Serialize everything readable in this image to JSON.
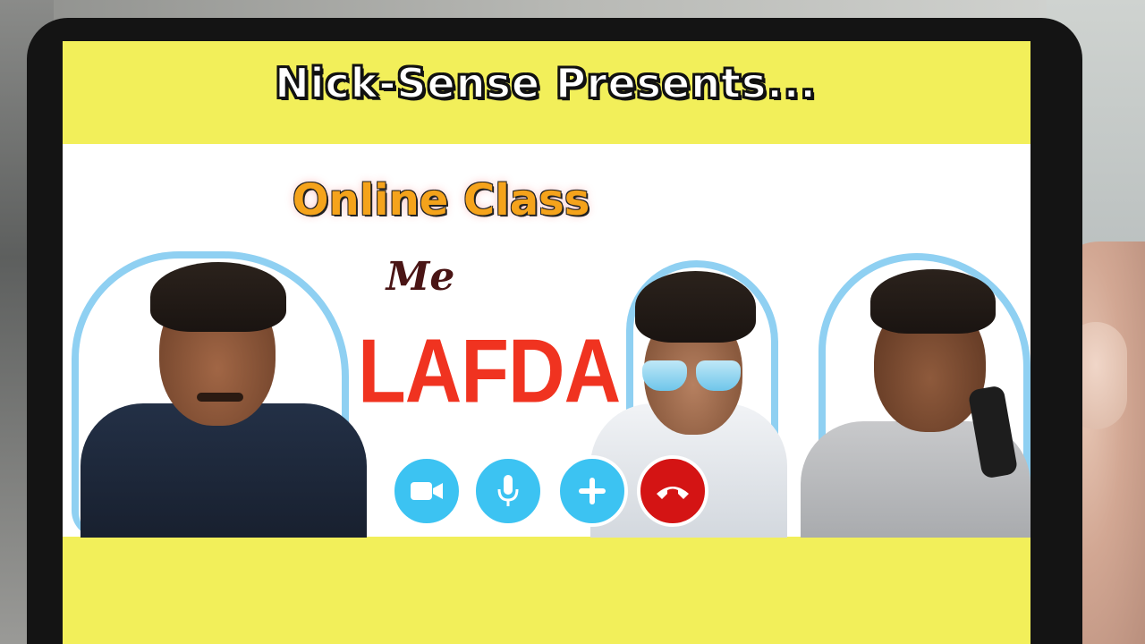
{
  "thumbnail": {
    "presents_text": "Nick-Sense Presents...",
    "title_line1": "Online Class",
    "title_line2": "Me",
    "title_line3": "LAFDA"
  },
  "call_controls": [
    {
      "name": "video-camera",
      "icon": "video-camera-icon"
    },
    {
      "name": "microphone",
      "icon": "microphone-icon"
    },
    {
      "name": "add-participant",
      "icon": "plus-icon"
    },
    {
      "name": "end-call",
      "icon": "phone-hangup-icon"
    }
  ],
  "colors": {
    "banner_yellow": "#f2ef5a",
    "title_orange": "#f5a31b",
    "lafda_red": "#f03320",
    "me_brown": "#4a1515",
    "control_blue": "#3cc3f2",
    "end_call_red": "#d41414",
    "outline_blue": "#8fd0f2"
  }
}
